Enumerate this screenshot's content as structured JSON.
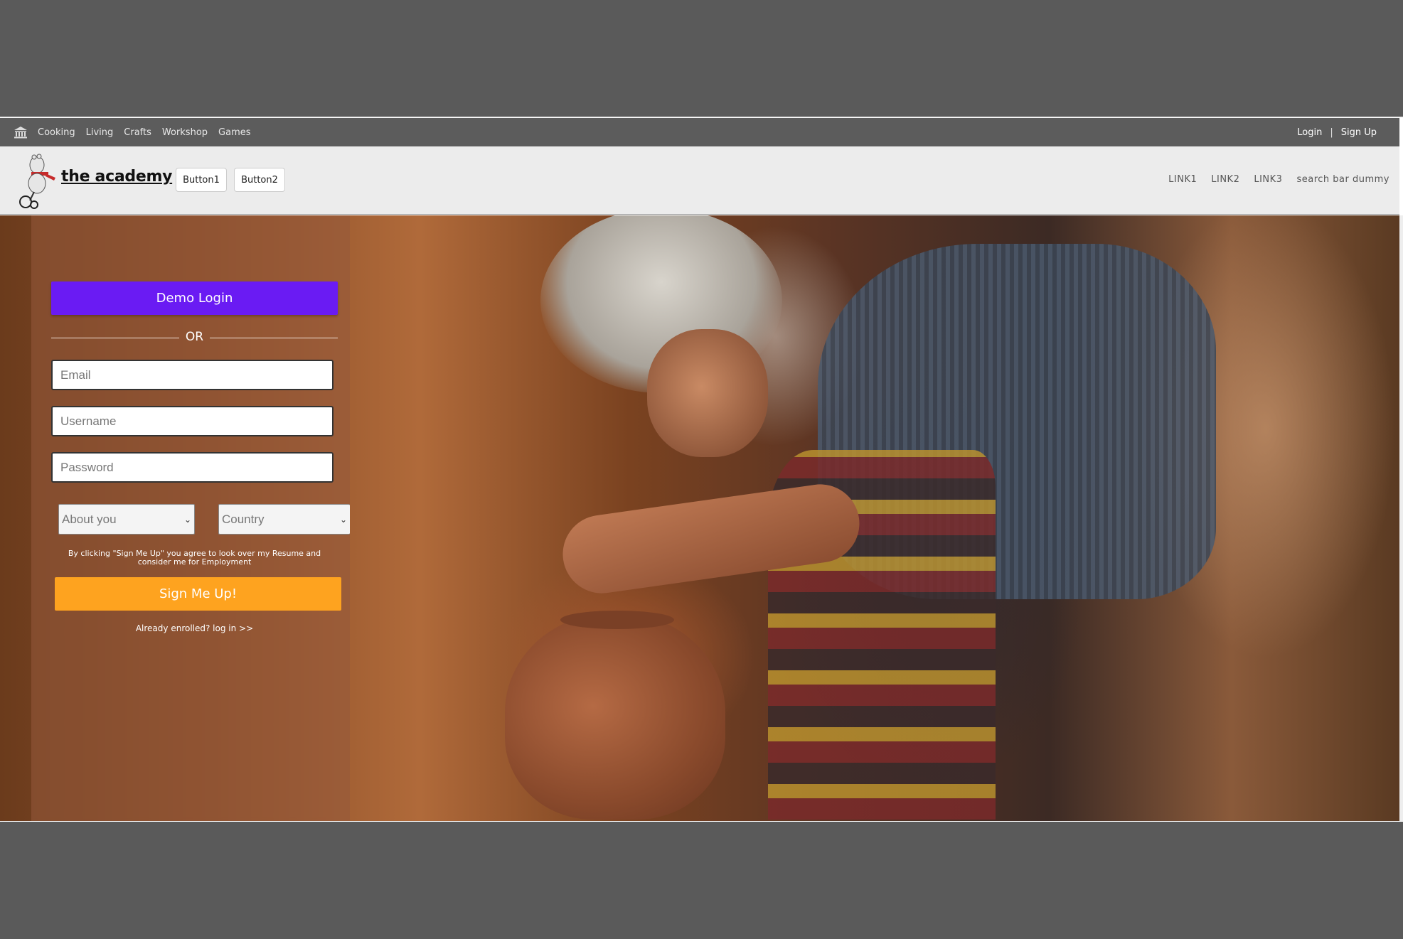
{
  "topnav": {
    "home_icon": "museum-icon",
    "links": [
      "Cooking",
      "Living",
      "Crafts",
      "Workshop",
      "Games"
    ],
    "login": "Login",
    "separator": "|",
    "signup": "Sign Up"
  },
  "header": {
    "brand": "the academy",
    "button1": "Button1",
    "button2": "Button2",
    "links": [
      "LINK1",
      "LINK2",
      "LINK3",
      "search bar dummy"
    ]
  },
  "form": {
    "demo_login": "Demo Login",
    "or": "OR",
    "email_placeholder": "Email",
    "username_placeholder": "Username",
    "password_placeholder": "Password",
    "about_select": "About you",
    "country_select": "Country",
    "terms": "By clicking \"Sign Me Up\" you agree to look over my Resume and consider me for Employment",
    "signup_button": "Sign Me Up!",
    "already": "Already enrolled? log in >>"
  },
  "colors": {
    "demo_button": "#6a1bf3",
    "signup_button": "#fea31f",
    "topnav_bg": "#5c5c5c"
  }
}
